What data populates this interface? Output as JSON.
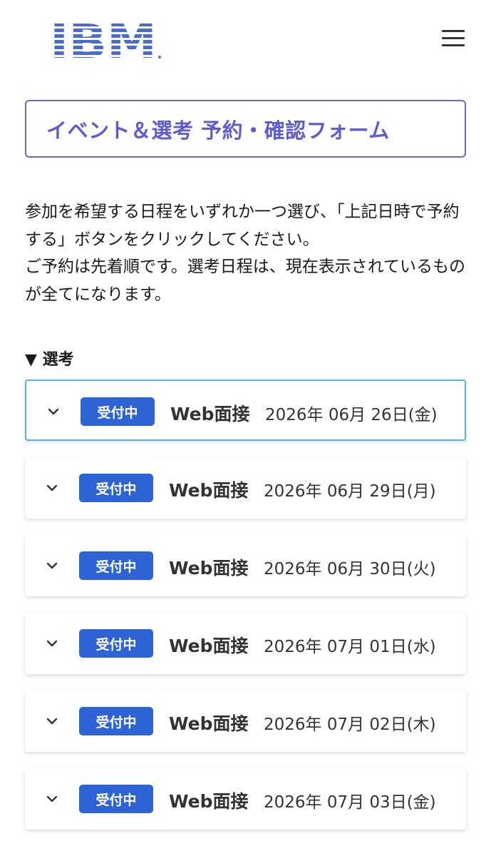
{
  "header": {
    "logo_text": "IBM",
    "menu_icon": "hamburger-icon"
  },
  "form_title": "イベント＆選考 予約・確認フォーム",
  "intro": {
    "line1": "参加を希望する日程をいずれか一つ選び、「上記日時で予約する」ボタンをクリックしてください。",
    "line2": "ご予約は先着順です。選考日程は、現在表示されているものが全てになります。"
  },
  "section": {
    "heading": "▼ 選考"
  },
  "colors": {
    "title_accent": "#5f5bd0",
    "badge_bg": "#2e63d6",
    "active_border": "#5bb3d6"
  },
  "slots": [
    {
      "status": "受付中",
      "type": "Web面接",
      "date": "2026年 06月 26日(金)"
    },
    {
      "status": "受付中",
      "type": "Web面接",
      "date": "2026年 06月 29日(月)"
    },
    {
      "status": "受付中",
      "type": "Web面接",
      "date": "2026年 06月 30日(火)"
    },
    {
      "status": "受付中",
      "type": "Web面接",
      "date": "2026年 07月 01日(水)"
    },
    {
      "status": "受付中",
      "type": "Web面接",
      "date": "2026年 07月 02日(木)"
    },
    {
      "status": "受付中",
      "type": "Web面接",
      "date": "2026年 07月 03日(金)"
    }
  ]
}
